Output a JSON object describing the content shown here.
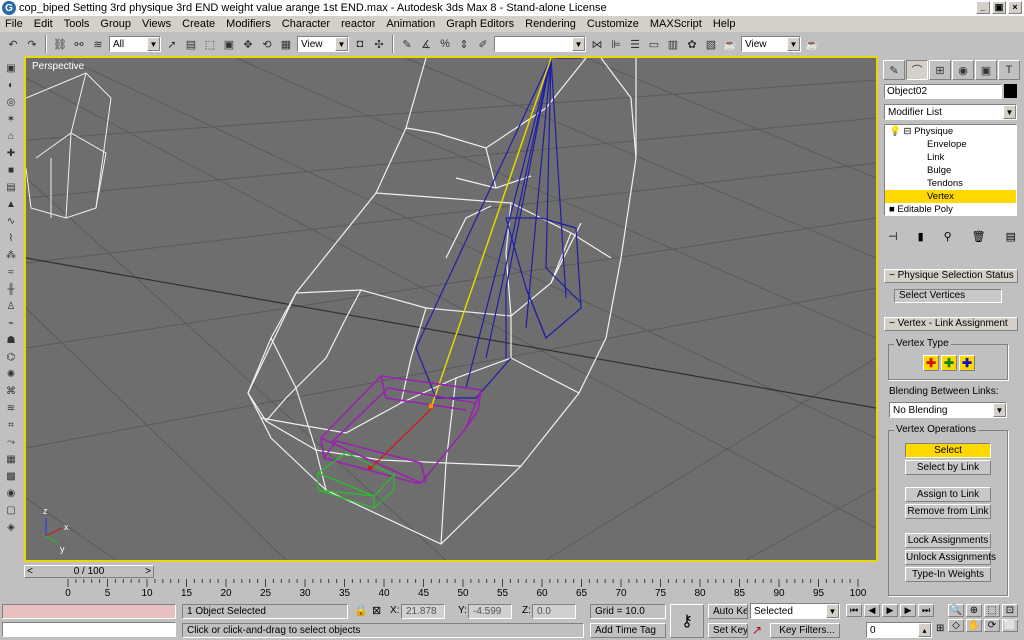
{
  "window": {
    "title": "cop_biped Setting 3rd physique 3rd END weight value arange 1st END.max - Autodesk 3ds Max 8 - Stand-alone License",
    "min": "_",
    "max": "□",
    "close": "×",
    "restore": "▣"
  },
  "menu": [
    "File",
    "Edit",
    "Tools",
    "Group",
    "Views",
    "Create",
    "Modifiers",
    "Character",
    "reactor",
    "Animation",
    "Graph Editors",
    "Rendering",
    "Customize",
    "MAXScript",
    "Help"
  ],
  "toolbar": {
    "selection_filter": "All",
    "ref_coord": "View",
    "named_selection": "",
    "render_view": "View"
  },
  "viewport": {
    "label": "Perspective"
  },
  "timeslider": {
    "value": "0 / 100",
    "prev": "<",
    "next": ">"
  },
  "trackbar": {
    "ticks": [
      "0",
      "5",
      "10",
      "15",
      "20",
      "25",
      "30",
      "35",
      "40",
      "45",
      "50",
      "55",
      "60",
      "65",
      "70",
      "75",
      "80",
      "85",
      "90",
      "95",
      "100"
    ]
  },
  "command_panel": {
    "object_name": "Object02",
    "modifier_list": "Modifier List",
    "stack": [
      {
        "label": "Physique",
        "prefix": "⊟",
        "selected": false
      },
      {
        "label": "Envelope",
        "prefix": "",
        "selected": false
      },
      {
        "label": "Link",
        "prefix": "",
        "selected": false
      },
      {
        "label": "Bulge",
        "prefix": "",
        "selected": false
      },
      {
        "label": "Tendons",
        "prefix": "",
        "selected": false
      },
      {
        "label": "Vertex",
        "prefix": "",
        "selected": true
      },
      {
        "label": "Editable Poly",
        "prefix": "■",
        "selected": false
      }
    ],
    "rollout1": {
      "title": "Physique Selection Status",
      "status": "Select Vertices"
    },
    "rollout2": {
      "title": "Vertex - Link Assignment",
      "vertex_type_label": "Vertex Type",
      "blending_label": "Blending Between Links:",
      "blending_value": "No Blending",
      "ops_label": "Vertex Operations",
      "buttons": {
        "select": "Select",
        "select_by_link": "Select by Link",
        "assign_to_link": "Assign to Link",
        "remove_from_link": "Remove from Link",
        "lock": "Lock Assignments",
        "unlock": "Unlock Assignments",
        "typein": "Type-In Weights"
      }
    }
  },
  "status": {
    "selection": "1 Object Selected",
    "prompt": "Click or click-and-drag to select objects",
    "x_label": "X:",
    "x": "21.878",
    "y_label": "Y:",
    "y": "-4.599",
    "z_label": "Z:",
    "z": "0.0",
    "grid": "Grid = 10.0",
    "add_time_tag": "Add Time Tag",
    "auto_key": "Auto Key",
    "set_key": "Set Key",
    "key_mode": "Selected",
    "key_filters": "Key Filters...",
    "frame": "0"
  },
  "colors": {
    "viewport_bg": "#6e6e6e",
    "active_border": "#e8d800",
    "selected_row": "#ffd800"
  }
}
